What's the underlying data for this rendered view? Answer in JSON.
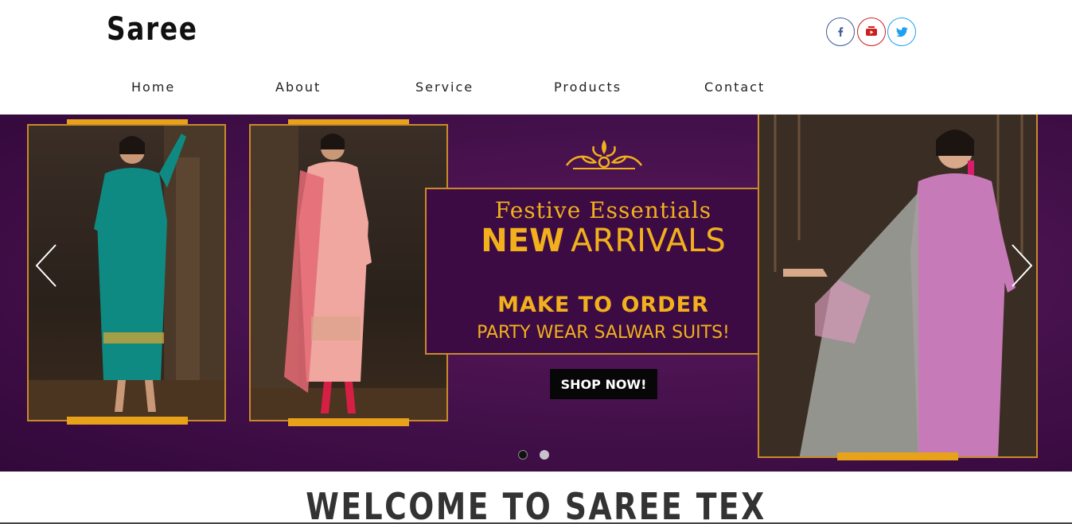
{
  "header": {
    "brand": "Saree",
    "social": [
      {
        "name": "facebook",
        "icon": "facebook-icon",
        "color": "#3b5998"
      },
      {
        "name": "youtube",
        "icon": "youtube-icon",
        "color": "#cc1f1f"
      },
      {
        "name": "twitter",
        "icon": "twitter-icon",
        "color": "#1da1f2"
      }
    ]
  },
  "nav": {
    "items": [
      "Home",
      "About",
      "Service",
      "Products",
      "Contact"
    ]
  },
  "hero": {
    "promo_line1": "Festive Essentials",
    "promo_line2_bold": "NEW",
    "promo_line2_regular": "ARRIVALS",
    "promo_line3": "MAKE TO ORDER",
    "promo_line4": "PARTY WEAR SALWAR SUITS!",
    "cta_label": "SHOP NOW!",
    "prev_icon": "chevron-left-icon",
    "next_icon": "chevron-right-icon",
    "slide_count": 2,
    "active_slide": 1,
    "colors": {
      "background": "#43104a",
      "accent": "#f1b01c",
      "frame": "#c98a2a"
    }
  },
  "welcome": {
    "title": "WELCOME TO SAREE TEX"
  }
}
